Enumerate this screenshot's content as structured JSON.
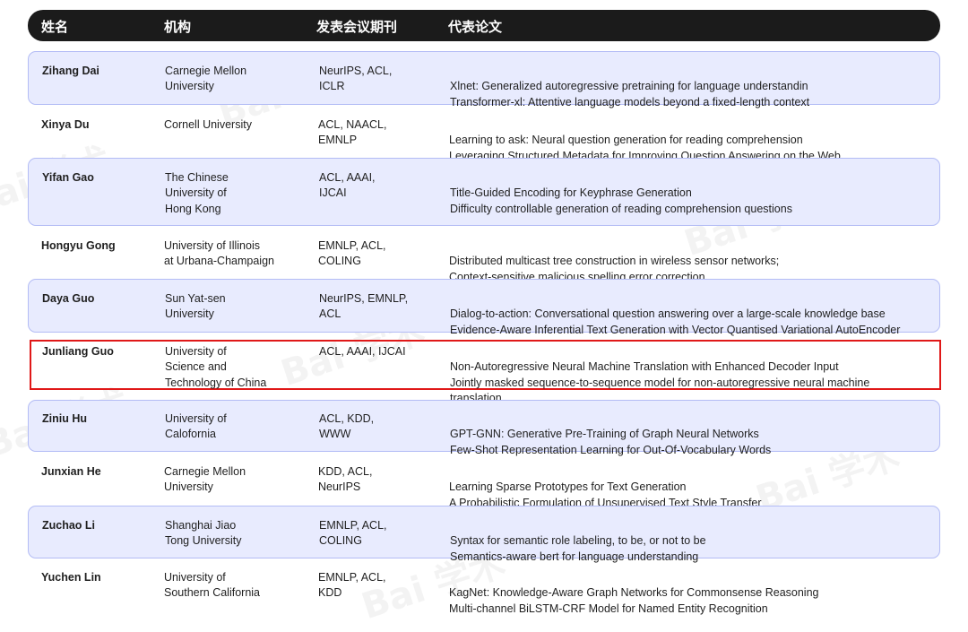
{
  "watermark": "Bai 学术",
  "header": {
    "name": "姓名",
    "org": "机构",
    "venue": "发表会议期刊",
    "paper": "代表论文"
  },
  "rows": [
    {
      "name": "Zihang Dai",
      "org": [
        "Carnegie Mellon",
        "University"
      ],
      "venue": [
        "NeurIPS, ACL,",
        "ICLR"
      ],
      "papers": [
        "Xlnet: Generalized autoregressive pretraining for language understandin",
        "Transformer-xl: Attentive language models beyond a fixed-length context"
      ]
    },
    {
      "name": "Xinya Du",
      "org": [
        "Cornell University"
      ],
      "venue": [
        "ACL, NAACL,",
        "EMNLP"
      ],
      "papers": [
        "Learning to ask: Neural question generation for reading comprehension",
        "Leveraging Structured Metadata for Improving Question Answering on the Web"
      ]
    },
    {
      "name": "Yifan Gao",
      "org": [
        "The Chinese",
        "University of",
        "Hong Kong"
      ],
      "venue": [
        "ACL, AAAI,",
        "IJCAI"
      ],
      "papers": [
        "Title-Guided Encoding for Keyphrase Generation",
        "Difficulty controllable generation of reading comprehension questions"
      ]
    },
    {
      "name": "Hongyu Gong",
      "org": [
        "University of Illinois",
        "at Urbana-Champaign"
      ],
      "venue": [
        "EMNLP, ACL,",
        "COLING"
      ],
      "papers": [
        "Distributed multicast tree construction in wireless sensor networks;",
        "Context-sensitive malicious spelling error correction"
      ]
    },
    {
      "name": "Daya Guo",
      "org": [
        "Sun Yat-sen",
        "University"
      ],
      "venue": [
        "NeurIPS, EMNLP,",
        "ACL"
      ],
      "papers": [
        "Dialog-to-action: Conversational question answering over a large-scale knowledge base",
        "Evidence-Aware Inferential Text Generation with Vector Quantised Variational AutoEncoder"
      ]
    },
    {
      "name": "Junliang Guo",
      "org": [
        "University of",
        "Science and",
        "Technology of China"
      ],
      "venue": [
        "ACL, AAAI, IJCAI"
      ],
      "papers": [
        "Non-Autoregressive Neural Machine Translation with Enhanced Decoder Input",
        "Jointly masked sequence-to-sequence model for non-autoregressive neural machine translation"
      ]
    },
    {
      "name": "Ziniu Hu",
      "org": [
        "University of",
        "Calofornia"
      ],
      "venue": [
        "ACL, KDD,",
        "WWW"
      ],
      "papers": [
        "GPT-GNN: Generative Pre-Training of Graph Neural Networks",
        "Few-Shot Representation Learning for Out-Of-Vocabulary Words"
      ]
    },
    {
      "name": "Junxian He",
      "org": [
        "Carnegie Mellon",
        "University"
      ],
      "venue": [
        "KDD, ACL,",
        "NeurIPS"
      ],
      "papers": [
        "Learning Sparse Prototypes for Text Generation",
        "A Probabilistic Formulation of Unsupervised Text Style Transfer"
      ]
    },
    {
      "name": "Zuchao Li",
      "org": [
        "Shanghai Jiao",
        "Tong University"
      ],
      "venue": [
        "EMNLP, ACL,",
        "COLING"
      ],
      "papers": [
        "Syntax for semantic role labeling, to be, or not to be",
        "Semantics-aware bert for language understanding"
      ]
    },
    {
      "name": "Yuchen Lin",
      "org": [
        "University of",
        "Southern California"
      ],
      "venue": [
        "EMNLP, ACL,",
        "KDD"
      ],
      "papers": [
        "KagNet: Knowledge-Aware Graph Networks for Commonsense Reasoning",
        "Multi-channel BiLSTM-CRF Model for Named Entity Recognition"
      ]
    }
  ]
}
